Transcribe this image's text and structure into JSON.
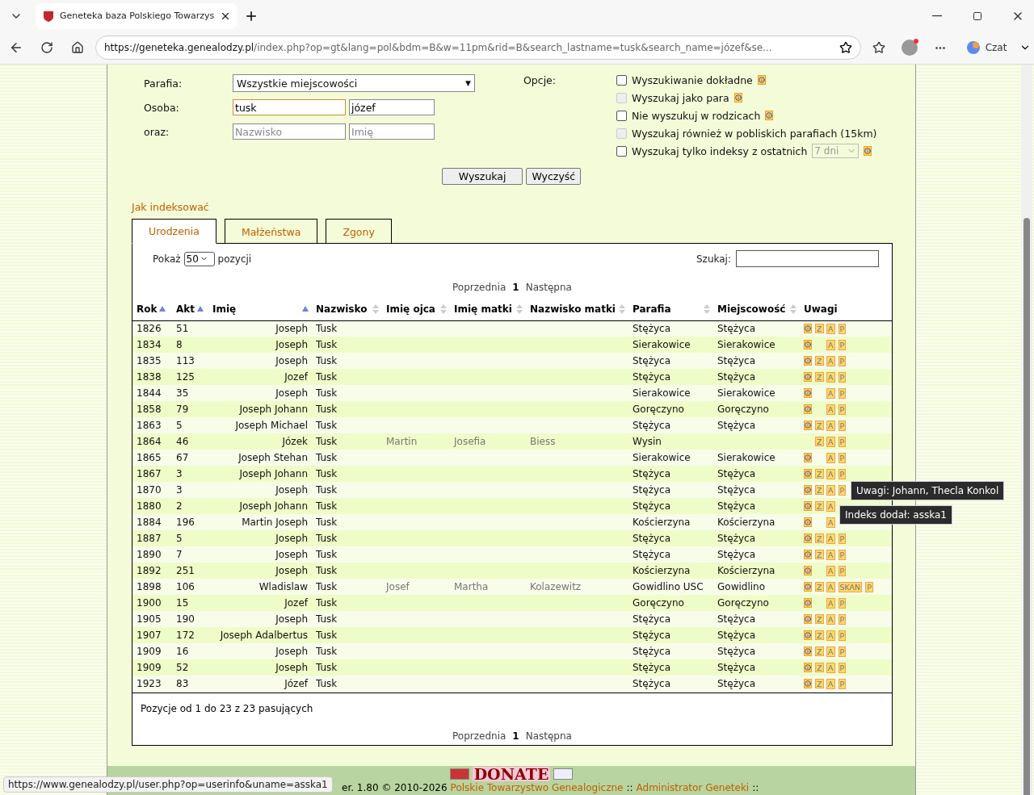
{
  "browser": {
    "tab_title": "Geneteka baza Polskiego Towarzys",
    "url_host": "https://geneteka.genealodzy.pl",
    "url_path": "/index.php?op=gt&lang=pol&bdm=B&w=11pm&rid=B&search_lastname=tusk&search_name=józef&se...",
    "copilot_label": "Czat"
  },
  "form": {
    "parish_label": "Parafia:",
    "parish_value": "Wszystkie miejscowości",
    "parish_arrow": "▼",
    "person_label": "Osoba:",
    "person_lastname": "tusk",
    "person_name": "józef",
    "and_label": "oraz:",
    "and_lastname_placeholder": "Nazwisko",
    "and_name_placeholder": "Imię",
    "options_label": "Opcje:",
    "options": [
      {
        "kind": "check",
        "label": "Wyszukiwanie dokładne",
        "checked": false,
        "disabled": false,
        "info": true
      },
      {
        "kind": "check",
        "label": "Wyszukaj jako para",
        "checked": false,
        "disabled": true,
        "info": true
      },
      {
        "kind": "check",
        "label": "Nie wyszukuj w rodzicach",
        "checked": false,
        "disabled": false,
        "info": true
      },
      {
        "kind": "check",
        "label": "Wyszukaj również w pobliskich parafiach (15km)",
        "checked": false,
        "disabled": true,
        "info": false
      },
      {
        "kind": "select",
        "label": "Wyszukaj tylko indeksy z ostatnich",
        "checked": false,
        "disabled": false,
        "info": true,
        "select_value": "7 dni"
      }
    ],
    "buttons": [
      "Wyszukaj",
      "Wyczyść"
    ]
  },
  "help_link": "Jak indeksować",
  "tabs": [
    {
      "label": "Urodzenia",
      "selected": true
    },
    {
      "label": "Małżeństwa",
      "selected": false
    },
    {
      "label": "Zgony",
      "selected": false
    }
  ],
  "table": {
    "show_label": "Pokaż",
    "page_size": "50",
    "show_suffix": "pozycji",
    "search_label": "Szukaj:",
    "pager": {
      "prev": "Poprzednia",
      "current": "1",
      "next": "Następna"
    },
    "columns": [
      {
        "label": "Rok",
        "sortable": true,
        "sorted": true
      },
      {
        "label": "Akt",
        "sortable": true,
        "sorted": true
      },
      {
        "label": "Imię",
        "sortable": true,
        "sorted": true
      },
      {
        "label": "Nazwisko",
        "sortable": true,
        "sorted": false
      },
      {
        "label": "Imię ojca",
        "sortable": true,
        "sorted": false
      },
      {
        "label": "Imię matki",
        "sortable": true,
        "sorted": false
      },
      {
        "label": "Nazwisko matki",
        "sortable": true,
        "sorted": false
      },
      {
        "label": "Parafia",
        "sortable": true,
        "sorted": false
      },
      {
        "label": "Miejscowość",
        "sortable": true,
        "sorted": false
      },
      {
        "label": "Uwagi",
        "sortable": false
      }
    ],
    "rows": [
      {
        "cells": [
          "1826",
          "51",
          "Joseph",
          "Tusk",
          "",
          "",
          "",
          "Stężyca",
          "Stężyca"
        ],
        "info": true,
        "z": "Z",
        "a": "A",
        "p": "P"
      },
      {
        "cells": [
          "1834",
          "8",
          "Joseph",
          "Tusk",
          "",
          "",
          "",
          "Sierakowice",
          "Sierakowice"
        ],
        "info": true,
        "a": "A",
        "p": "P"
      },
      {
        "cells": [
          "1835",
          "113",
          "Joseph",
          "Tusk",
          "",
          "",
          "",
          "Stężyca",
          "Stężyca"
        ],
        "info": true,
        "z": "Z",
        "a": "A",
        "p": "P"
      },
      {
        "cells": [
          "1838",
          "125",
          "Jozef",
          "Tusk",
          "",
          "",
          "",
          "Stężyca",
          "Stężyca"
        ],
        "info": true,
        "z": "Z",
        "a": "A",
        "p": "P"
      },
      {
        "cells": [
          "1844",
          "35",
          "Joseph",
          "Tusk",
          "",
          "",
          "",
          "Sierakowice",
          "Sierakowice"
        ],
        "info": true,
        "a": "A",
        "p": "P"
      },
      {
        "cells": [
          "1858",
          "79",
          "Joseph Johann",
          "Tusk",
          "",
          "",
          "",
          "Goręczyno",
          "Goręczyno"
        ],
        "info": true,
        "a": "A",
        "p": "P"
      },
      {
        "cells": [
          "1863",
          "5",
          "Joseph Michael",
          "Tusk",
          "",
          "",
          "",
          "Stężyca",
          "Stężyca"
        ],
        "info": true,
        "z": "Z",
        "a": "A",
        "p": "P"
      },
      {
        "cells": [
          "1864",
          "46",
          "Józek",
          "Tusk",
          "Martin",
          "Josefia",
          "Biess",
          "Wysin",
          ""
        ],
        "info": false,
        "z": "Z",
        "a": "A",
        "p": "P"
      },
      {
        "cells": [
          "1865",
          "67",
          "Joseph Stehan",
          "Tusk",
          "",
          "",
          "",
          "Sierakowice",
          "Sierakowice"
        ],
        "info": true,
        "a": "A",
        "p": "P"
      },
      {
        "cells": [
          "1867",
          "3",
          "Joseph Johann",
          "Tusk",
          "",
          "",
          "",
          "Stężyca",
          "Stężyca"
        ],
        "info": true,
        "z": "Z",
        "a": "A",
        "p": "P"
      },
      {
        "cells": [
          "1870",
          "3",
          "Joseph",
          "Tusk",
          "",
          "",
          "",
          "Stężyca",
          "Stężyca"
        ],
        "info": true,
        "z": "Z",
        "a": "A",
        "p": "P"
      },
      {
        "cells": [
          "1880",
          "2",
          "Joseph Johann",
          "Tusk",
          "",
          "",
          "",
          "Stężyca",
          "Stężyca"
        ],
        "info": true,
        "z": "Z",
        "a": "A"
      },
      {
        "cells": [
          "1884",
          "196",
          "Martin Joseph",
          "Tusk",
          "",
          "",
          "",
          "Kościerzyna",
          "Kościerzyna"
        ],
        "info": true,
        "a": "A"
      },
      {
        "cells": [
          "1887",
          "5",
          "Joseph",
          "Tusk",
          "",
          "",
          "",
          "Stężyca",
          "Stężyca"
        ],
        "info": true,
        "z": "Z",
        "a": "A",
        "p": "P"
      },
      {
        "cells": [
          "1890",
          "7",
          "Joseph",
          "Tusk",
          "",
          "",
          "",
          "Stężyca",
          "Stężyca"
        ],
        "info": true,
        "z": "Z",
        "a": "A",
        "p": "P"
      },
      {
        "cells": [
          "1892",
          "251",
          "Joseph",
          "Tusk",
          "",
          "",
          "",
          "Kościerzyna",
          "Kościerzyna"
        ],
        "info": true,
        "a": "A",
        "p": "P"
      },
      {
        "cells": [
          "1898",
          "106",
          "Wladislaw",
          "Tusk",
          "Josef",
          "Martha",
          "Kolazewitz",
          "Gowidlino USC",
          "Gowidlino"
        ],
        "info": true,
        "z": "Z",
        "a": "A",
        "skan": "SKAN",
        "p": "P"
      },
      {
        "cells": [
          "1900",
          "15",
          "Jozef",
          "Tusk",
          "",
          "",
          "",
          "Goręczyno",
          "Goręczyno"
        ],
        "info": true,
        "a": "A",
        "p": "P"
      },
      {
        "cells": [
          "1905",
          "190",
          "Joseph",
          "Tusk",
          "",
          "",
          "",
          "Stężyca",
          "Stężyca"
        ],
        "info": true,
        "z": "Z",
        "a": "A",
        "p": "P"
      },
      {
        "cells": [
          "1907",
          "172",
          "Joseph Adalbertus",
          "Tusk",
          "",
          "",
          "",
          "Stężyca",
          "Stężyca"
        ],
        "info": true,
        "z": "Z",
        "a": "A",
        "p": "P"
      },
      {
        "cells": [
          "1909",
          "16",
          "Joseph",
          "Tusk",
          "",
          "",
          "",
          "Stężyca",
          "Stężyca"
        ],
        "info": true,
        "z": "Z",
        "a": "A",
        "p": "P"
      },
      {
        "cells": [
          "1909",
          "52",
          "Joseph",
          "Tusk",
          "",
          "",
          "",
          "Stężyca",
          "Stężyca"
        ],
        "info": true,
        "z": "Z",
        "a": "A",
        "p": "P"
      },
      {
        "cells": [
          "1923",
          "83",
          "Józef",
          "Tusk",
          "",
          "",
          "",
          "Stężyca",
          "Stężyca"
        ],
        "info": true,
        "z": "Z",
        "a": "A",
        "p": "P"
      }
    ],
    "summary": "Pozycje od 1 do 23 z 23 pasujących",
    "bottom_pager": {
      "prev": "Poprzednia",
      "current": "1",
      "next": "Następna"
    }
  },
  "tooltips": [
    "Uwagi: Johann, Thecla Konkol",
    "Indeks dodał: asska1"
  ],
  "footer": {
    "donate": "DONATE",
    "version": "er. 1.80 © 2010-2026",
    "links": [
      "Polskie Towarzystwo Genealogiczne",
      "Administrator Geneteki"
    ],
    "separator": "::"
  },
  "status_url": "https://www.genealodzy.pl/user.php?op=userinfo&uname=asska1"
}
